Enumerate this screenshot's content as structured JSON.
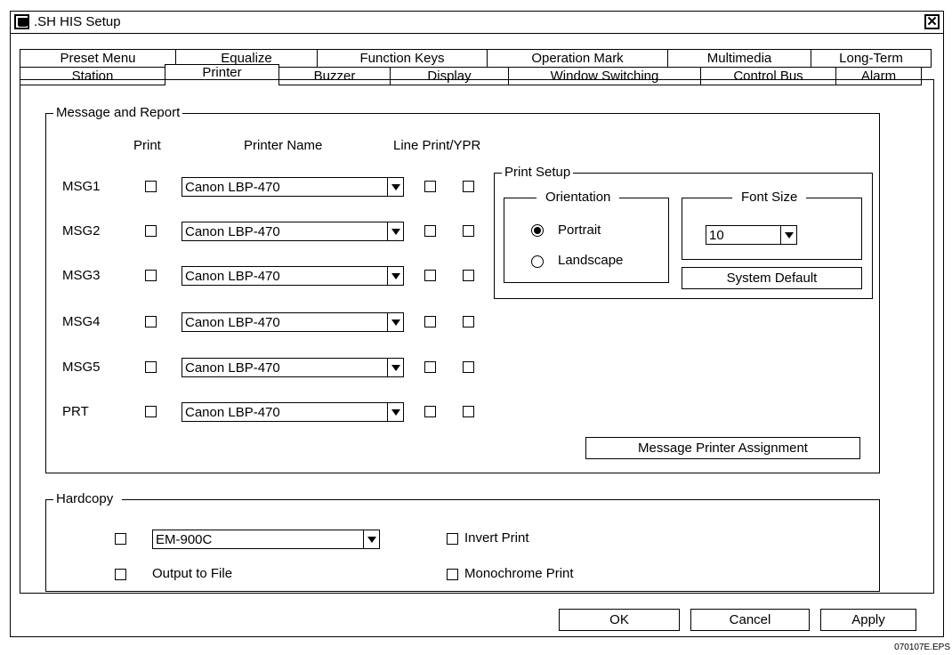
{
  "window": {
    "title": ".SH HIS Setup"
  },
  "tabs_row1": [
    "Preset Menu",
    "Equalize",
    "Function Keys",
    "Operation Mark",
    "Multimedia",
    "Long-Term"
  ],
  "tabs_row2": [
    "Station",
    "Printer",
    "Buzzer",
    "Display",
    "Window Switching",
    "Control Bus",
    "Alarm"
  ],
  "active_tab": "Printer",
  "message_report": {
    "legend": "Message and Report",
    "col_print": "Print",
    "col_printer_name": "Printer Name",
    "col_line_print": "Line Print/YPR",
    "rows": [
      {
        "label": "MSG1",
        "printer": "Canon  LBP-470"
      },
      {
        "label": "MSG2",
        "printer": "Canon  LBP-470"
      },
      {
        "label": "MSG3",
        "printer": "Canon  LBP-470"
      },
      {
        "label": "MSG4",
        "printer": "Canon  LBP-470"
      },
      {
        "label": "MSG5",
        "printer": "Canon  LBP-470"
      },
      {
        "label": "PRT",
        "printer": "Canon  LBP-470"
      }
    ],
    "assign_button": "Message Printer Assignment"
  },
  "print_setup": {
    "legend": "Print Setup",
    "orientation_legend": "Orientation",
    "portrait": "Portrait",
    "landscape": "Landscape",
    "selected_orientation": "Portrait",
    "font_size_legend": "Font Size",
    "font_size_value": "10",
    "system_default_button": "System Default"
  },
  "hardcopy": {
    "legend": "Hardcopy",
    "device": "EM-900C",
    "output_to_file": "Output to File",
    "invert_print": "Invert Print",
    "monochrome_print": "Monochrome Print"
  },
  "buttons": {
    "ok": "OK",
    "cancel": "Cancel",
    "apply": "Apply"
  },
  "figure_code": "070107E.EPS"
}
